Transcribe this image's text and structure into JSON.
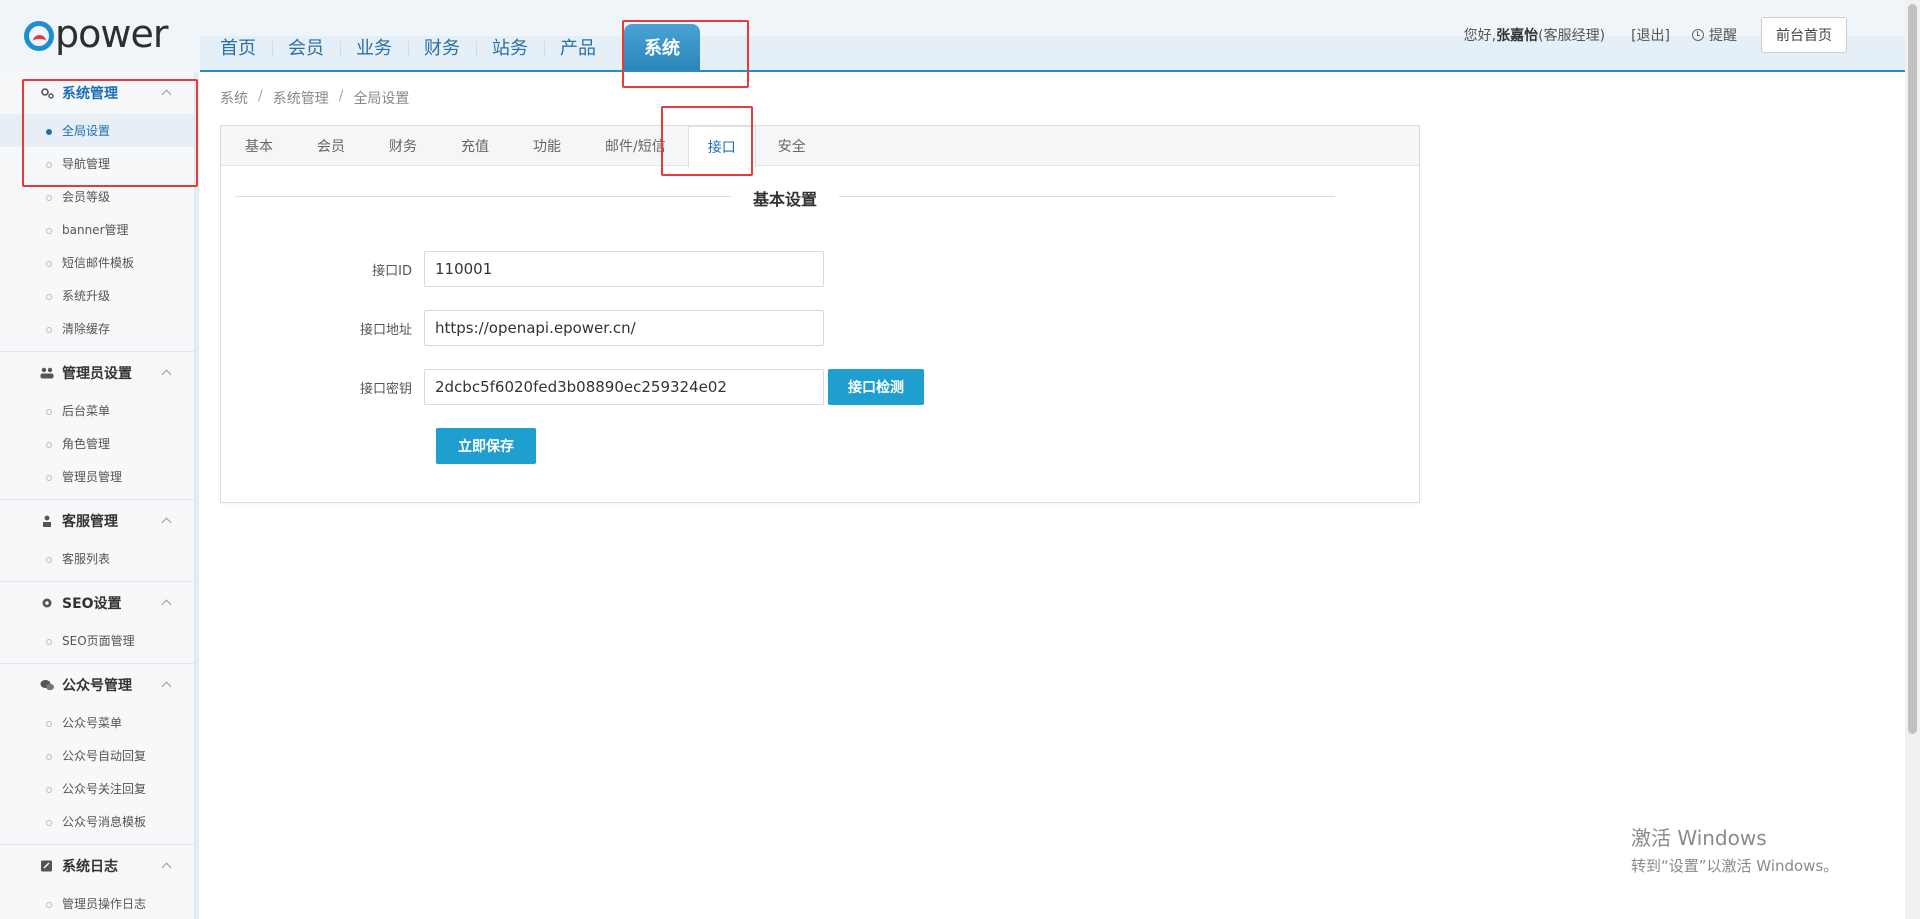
{
  "app": {
    "logo_text": "power"
  },
  "top_nav": [
    {
      "label": "首页"
    },
    {
      "label": "会员"
    },
    {
      "label": "业务"
    },
    {
      "label": "财务"
    },
    {
      "label": "站务"
    },
    {
      "label": "产品"
    },
    {
      "label": "系统"
    }
  ],
  "user": {
    "greeting": "您好,",
    "name": "张嘉怡",
    "role": "(客服经理)",
    "logout": "[退出]",
    "remind": "提醒",
    "front_home": "前台首页"
  },
  "sidebar": {
    "groups": [
      {
        "title": "系统管理",
        "icon": "gears-icon",
        "items": [
          "全局设置",
          "导航管理",
          "会员等级",
          "banner管理",
          "短信邮件模板",
          "系统升级",
          "清除缓存"
        ]
      },
      {
        "title": "管理员设置",
        "icon": "users-icon",
        "items": [
          "后台菜单",
          "角色管理",
          "管理员管理"
        ]
      },
      {
        "title": "客服管理",
        "icon": "headset-icon",
        "items": [
          "客服列表"
        ]
      },
      {
        "title": "SEO设置",
        "icon": "gear-icon",
        "items": [
          "SEO页面管理"
        ]
      },
      {
        "title": "公众号管理",
        "icon": "wechat-icon",
        "items": [
          "公众号菜单",
          "公众号自动回复",
          "公众号关注回复",
          "公众号消息模板"
        ]
      },
      {
        "title": "系统日志",
        "icon": "log-icon",
        "items": [
          "管理员操作日志"
        ]
      }
    ]
  },
  "breadcrumb": [
    "系统",
    "系统管理",
    "全局设置"
  ],
  "tabs": [
    "基本",
    "会员",
    "财务",
    "充值",
    "功能",
    "邮件/短信",
    "接口",
    "安全"
  ],
  "form": {
    "section_title": "基本设置",
    "api_id_label": "接口ID",
    "api_id_value": "110001",
    "api_url_label": "接口地址",
    "api_url_value": "https://openapi.epower.cn/",
    "api_key_label": "接口密钥",
    "api_key_value": "2dcbc5f6020fed3b08890ec259324e02",
    "check_button": "接口检测",
    "save_button": "立即保存"
  },
  "watermark": {
    "line1": "激活 Windows",
    "line2": "转到“设置”以激活 Windows。"
  },
  "colors": {
    "accent": "#1e9fd0",
    "nav_active": "#2a86ba",
    "highlight": "#e83a3a"
  }
}
